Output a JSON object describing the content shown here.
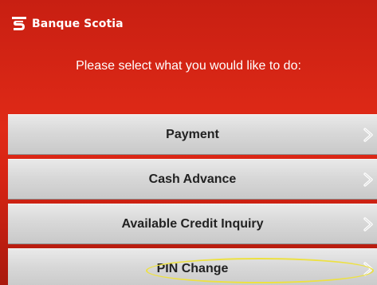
{
  "brand": {
    "name": "Banque Scotia",
    "logo_icon": "scotiabank-s-logo-icon",
    "accent_color": "#d72414"
  },
  "prompt": "Please select what you would like to do:",
  "menu": {
    "items": [
      {
        "label": "Payment",
        "icon": "chevron-right-icon"
      },
      {
        "label": "Cash Advance",
        "icon": "chevron-right-icon"
      },
      {
        "label": "Available Credit Inquiry",
        "icon": "chevron-right-icon"
      },
      {
        "label": "PIN Change",
        "icon": "chevron-right-icon",
        "highlighted": true
      }
    ]
  },
  "highlight_color": "#ede142"
}
